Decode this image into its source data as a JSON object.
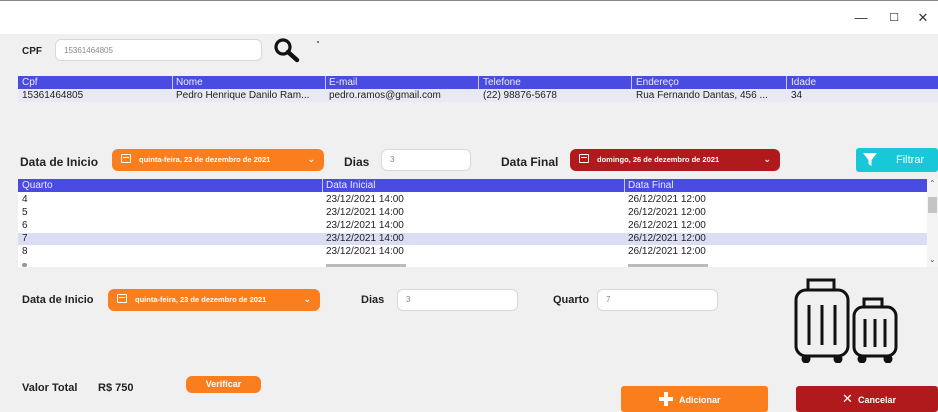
{
  "window": {
    "minimize_glyph": "—",
    "maximize_glyph": "☐",
    "close_glyph": "✕"
  },
  "search": {
    "cpf_label": "CPF",
    "cpf_value": "15361464805",
    "search_icon": "magnifier-icon"
  },
  "client_table": {
    "columns": [
      "Cpf",
      "Nome",
      "E-mail",
      "Telefone",
      "Endereço",
      "Idade"
    ],
    "rows": [
      [
        "15361464805",
        "Pedro Henrique Danilo Ram...",
        "pedro.ramos@gmail.com",
        "(22) 98876-5678",
        "Rua Fernando Dantas, 456 ...",
        "34"
      ]
    ]
  },
  "filter": {
    "start_label": "Data de Inicio",
    "start_date": "quinta-feira, 23 de dezembro de 2021",
    "days_label": "Dias",
    "days_value": "3",
    "end_label": "Data Final",
    "end_date": "domingo, 26 de dezembro de 2021",
    "filter_button": "Filtrar"
  },
  "rooms_table": {
    "columns": [
      "Quarto",
      "Data Inicial",
      "Data Final"
    ],
    "rows": [
      [
        "4",
        "23/12/2021 14:00",
        "26/12/2021 12:00"
      ],
      [
        "5",
        "23/12/2021 14:00",
        "26/12/2021 12:00"
      ],
      [
        "6",
        "23/12/2021 14:00",
        "26/12/2021 12:00"
      ],
      [
        "7",
        "23/12/2021 14:00",
        "26/12/2021 12:00"
      ],
      [
        "8",
        "23/12/2021 14:00",
        "26/12/2021 12:00"
      ]
    ],
    "selected_row": 3
  },
  "booking": {
    "start_label": "Data de Inicio",
    "start_date": "quinta-feira, 23 de dezembro de 2021",
    "days_label": "Dias",
    "days_value": "3",
    "room_label": "Quarto",
    "room_value": "7"
  },
  "total": {
    "label": "Valor Total",
    "value": "R$ 750",
    "verify_button": "Verificar"
  },
  "actions": {
    "add_button": "Adicionar",
    "cancel_button": "Cancelar"
  },
  "colors": {
    "header_blue": "#4a4be0",
    "orange": "#fb7e1e",
    "dark_red": "#b11a1c",
    "cyan": "#19c8d8"
  },
  "icons": {
    "luggage": "luggage-icon"
  }
}
